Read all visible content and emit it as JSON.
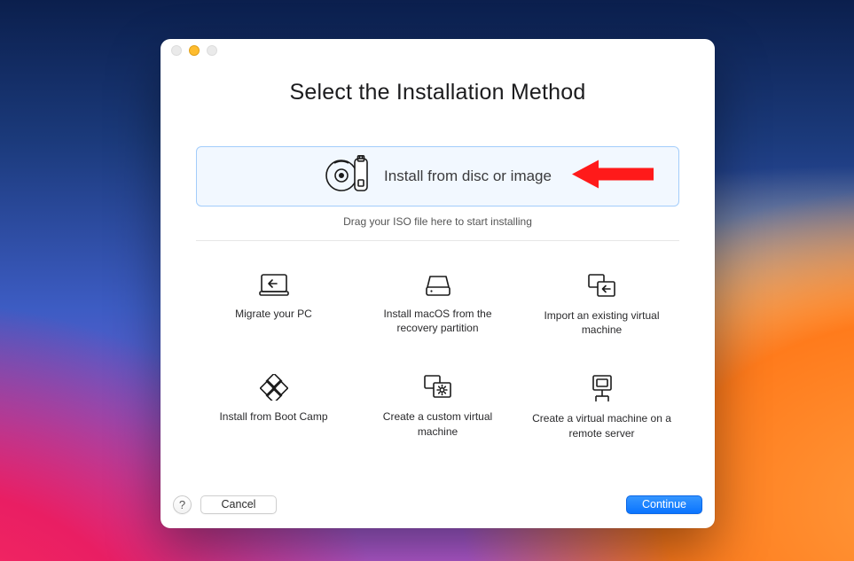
{
  "window": {
    "title": "Select the Installation Method"
  },
  "dropzone": {
    "label": "Install from disc or image",
    "hint": "Drag your ISO file here to start installing"
  },
  "options": {
    "migrate": "Migrate your PC",
    "recovery": "Install macOS from the recovery partition",
    "import": "Import an existing virtual machine",
    "bootcamp": "Install from Boot Camp",
    "custom": "Create a custom virtual machine",
    "remote": "Create a virtual machine on a remote server"
  },
  "footer": {
    "help": "?",
    "cancel": "Cancel",
    "continue": "Continue"
  },
  "colors": {
    "accent": "#0a74ff",
    "dropzone_border": "#a3cdfb",
    "dropzone_bg": "#f2f8ff",
    "annotation_arrow": "#ff1a1a"
  }
}
